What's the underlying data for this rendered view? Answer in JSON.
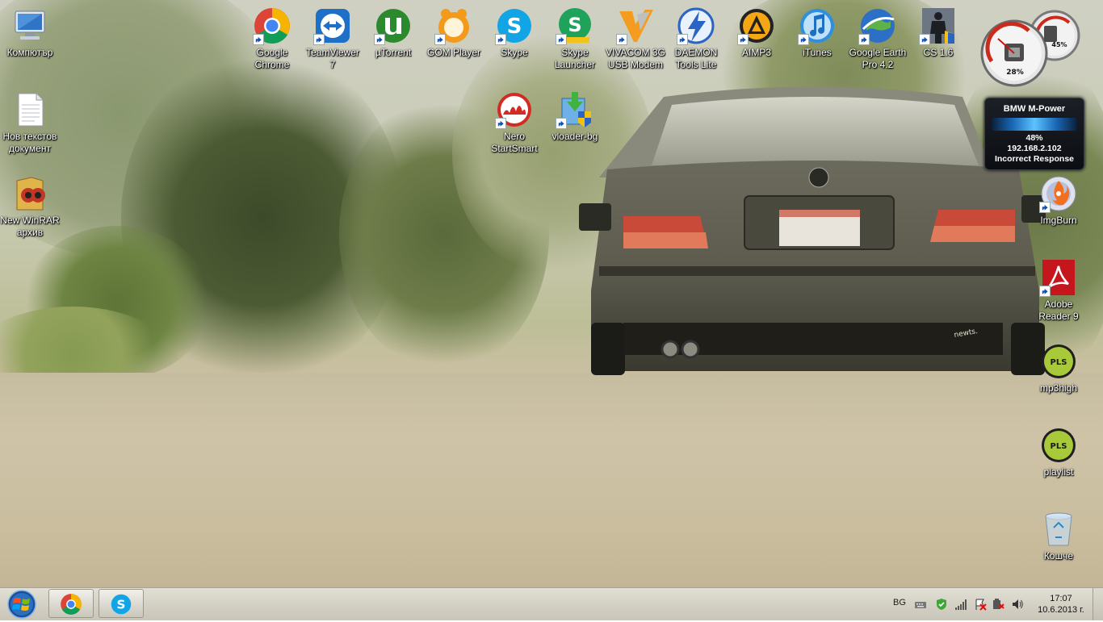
{
  "desktop": {
    "left_column": [
      {
        "name": "computer",
        "label": "Компютър",
        "icon": "computer-icon"
      },
      {
        "name": "new-text-doc",
        "label": "Нов текстов документ",
        "icon": "text-document-icon"
      },
      {
        "name": "winrar",
        "label": "New WinRAR архив",
        "icon": "winrar-archive-icon"
      }
    ],
    "top_row": [
      {
        "name": "google-chrome",
        "label": "Google Chrome",
        "icon": "chrome-icon"
      },
      {
        "name": "teamviewer",
        "label": "TeamViewer 7",
        "icon": "teamviewer-icon"
      },
      {
        "name": "utorrent",
        "label": "µTorrent",
        "icon": "utorrent-icon"
      },
      {
        "name": "gom-player",
        "label": "GOM Player",
        "icon": "gom-player-icon"
      },
      {
        "name": "skype",
        "label": "Skype",
        "icon": "skype-icon"
      },
      {
        "name": "skype-launcher",
        "label": "Skype Launcher",
        "icon": "skype-launcher-icon"
      },
      {
        "name": "vivacom",
        "label": "VIVACOM 3G USB Modem",
        "icon": "vivacom-icon"
      },
      {
        "name": "daemon-tools",
        "label": "DAEMON Tools Lite",
        "icon": "daemon-tools-icon"
      },
      {
        "name": "aimp3",
        "label": "AIMP3",
        "icon": "aimp-icon"
      },
      {
        "name": "itunes",
        "label": "iTunes",
        "icon": "itunes-icon"
      },
      {
        "name": "google-earth",
        "label": "Google Earth Pro 4.2",
        "icon": "google-earth-icon"
      },
      {
        "name": "cs16",
        "label": "CS 1.6",
        "icon": "counter-strike-icon"
      }
    ],
    "second_row": [
      {
        "name": "nero",
        "label": "Nero StartSmart",
        "icon": "nero-icon"
      },
      {
        "name": "vloader",
        "label": "vloader-bg",
        "icon": "vloader-icon"
      }
    ],
    "right_column": [
      {
        "name": "imgburn",
        "label": "ImgBurn",
        "icon": "imgburn-icon"
      },
      {
        "name": "adobe-reader",
        "label": "Adobe Reader 9",
        "icon": "adobe-reader-icon"
      },
      {
        "name": "mp3high",
        "label": "mp3high",
        "icon": "pls-playlist-icon",
        "badge": "PLS"
      },
      {
        "name": "playlist",
        "label": "playlist",
        "icon": "pls-playlist-icon",
        "badge": "PLS"
      },
      {
        "name": "recycle-bin",
        "label": "Кошче",
        "icon": "recycle-bin-icon"
      }
    ]
  },
  "gadgets": {
    "cpu_meter": {
      "cpu": "28%",
      "memory": "45%"
    },
    "mpower": {
      "title": "BMW M-Power",
      "signal": "48%",
      "ip": "192.168.2.102",
      "status": "Incorrect Response"
    }
  },
  "taskbar": {
    "pinned": [
      {
        "name": "chrome",
        "icon": "chrome-icon"
      },
      {
        "name": "skype",
        "icon": "skype-icon"
      }
    ],
    "tray": {
      "language": "BG",
      "time": "17:07",
      "date": "10.6.2013 г."
    }
  }
}
